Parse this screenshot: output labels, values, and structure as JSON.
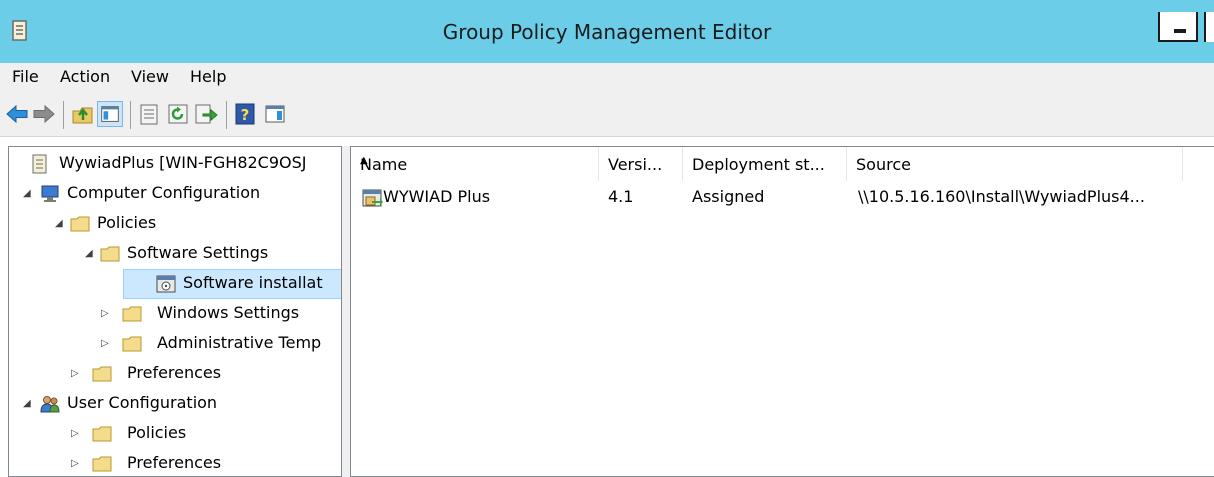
{
  "window": {
    "title": "Group Policy Management Editor"
  },
  "menu": [
    "File",
    "Action",
    "View",
    "Help"
  ],
  "toolbar": {
    "buttons": [
      "back-arrow-icon",
      "forward-arrow-icon",
      "up-folder-icon",
      "show-hide-console-tree-icon",
      "properties-icon",
      "refresh-icon",
      "export-list-icon",
      "help-icon",
      "show-action-pane-icon"
    ]
  },
  "tree": {
    "root": "WywiadPlus [WIN-FGH82C9OSJ",
    "computer_configuration": "Computer Configuration",
    "policies": "Policies",
    "software_settings": "Software Settings",
    "software_installation": "Software installat",
    "windows_settings": "Windows Settings",
    "administrative_templates": "Administrative Temp",
    "preferences": "Preferences",
    "user_configuration": "User Configuration",
    "user_policies": "Policies",
    "user_preferences": "Preferences",
    "expanded_glyph": "◢",
    "collapsed_glyph": "▷"
  },
  "list": {
    "columns": [
      "Name",
      "Versi...",
      "Deployment st...",
      "Source"
    ],
    "rows": [
      {
        "name": "WYWIAD Plus",
        "version": "4.1",
        "deployment_state": "Assigned",
        "source": "\\\\10.5.16.160\\Install\\WywiadPlus4..."
      }
    ]
  },
  "colors": {
    "titlebar": "#6ccde8",
    "selection": "#cce8ff",
    "chrome": "#f0f0f0"
  }
}
